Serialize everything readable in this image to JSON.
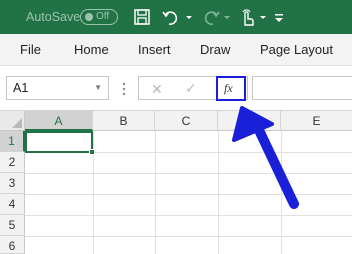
{
  "titlebar": {
    "autosave_label": "AutoSave",
    "autosave_state": "Off",
    "icons": [
      "save-icon",
      "undo-icon",
      "redo-icon",
      "touch-mode-icon",
      "customize-toolbar-icon"
    ]
  },
  "ribbon": {
    "tabs": [
      "File",
      "Home",
      "Insert",
      "Draw",
      "Page Layout"
    ]
  },
  "formula_bar": {
    "name_box_value": "A1",
    "fx_label": "fx",
    "formula_value": ""
  },
  "grid": {
    "columns": [
      "A",
      "B",
      "C",
      "D",
      "E"
    ],
    "rows": [
      "1",
      "2",
      "3",
      "4",
      "5",
      "6"
    ],
    "active_cell": "A1",
    "active_column": "A",
    "active_row": "1"
  },
  "colors": {
    "excel_green": "#217346",
    "annotation_blue": "#1a1fd8"
  }
}
